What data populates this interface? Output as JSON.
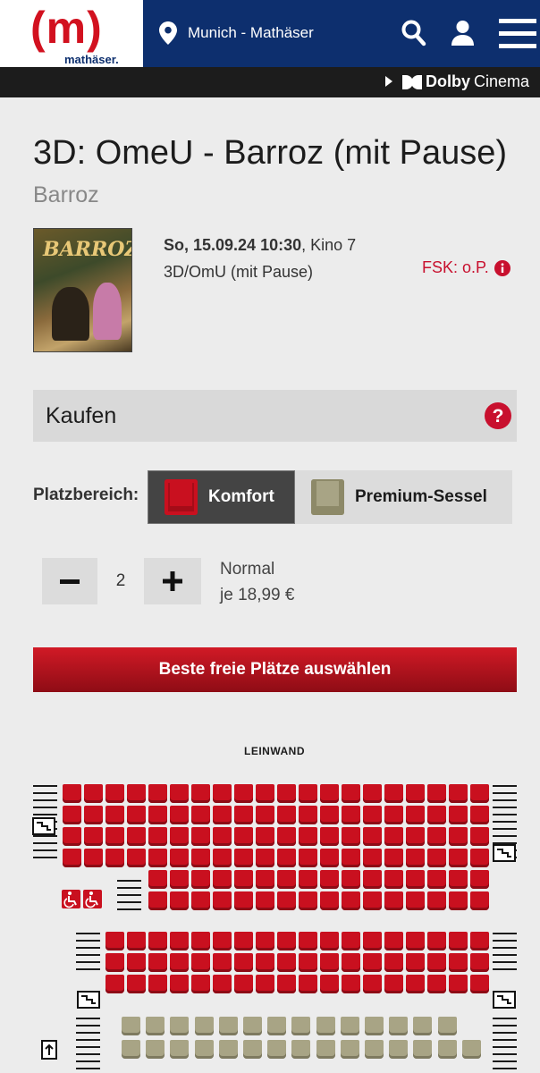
{
  "header": {
    "logo_mark": "(m)",
    "logo_text": "mathäser.",
    "location": "Munich - Mathäser",
    "dolby_bold": "Dolby",
    "dolby_rest": "Cinema"
  },
  "movie": {
    "title": "3D: OmeU - Barroz (mit Pause)",
    "original_title": "Barroz",
    "poster_title": "BARROZ",
    "datetime": "So, 15.09.24 10:30",
    "hall": ", Kino 7",
    "format": "3D/OmU (mit Pause)",
    "fsk": "FSK: o.P."
  },
  "booking": {
    "section_title": "Kaufen",
    "area_label": "Platzbereich:",
    "areas": [
      {
        "label": "Komfort",
        "color": "#c9101f",
        "selected": true
      },
      {
        "label": "Premium-Sessel",
        "color": "#a8a485",
        "selected": false
      }
    ],
    "quantity": "2",
    "ticket_type": "Normal",
    "price": "je 18,99 €",
    "best_seats_button": "Beste freie Plätze auswählen",
    "screen_label": "LEINWAND"
  },
  "colors": {
    "brand_red": "#c9101f",
    "brand_blue": "#0d2f6e",
    "premium_seat": "#a8a485"
  }
}
